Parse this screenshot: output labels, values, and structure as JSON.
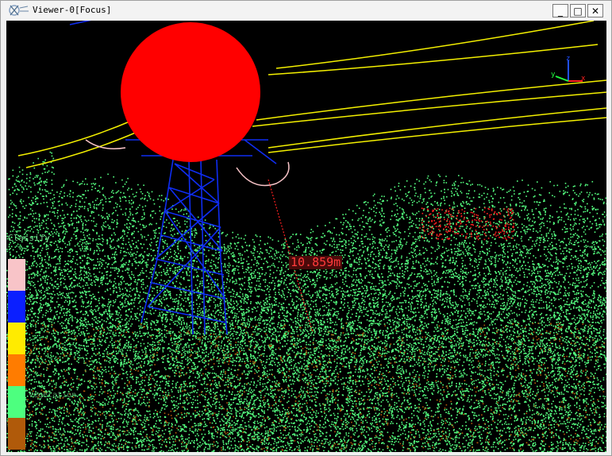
{
  "window": {
    "title": "Viewer-0[Focus]",
    "minimize_glyph": "_",
    "maximize_glyph": "□",
    "close_glyph": "✕"
  },
  "viewport": {
    "measurement_label": "10.859m",
    "legend_title": "Classify",
    "legend_colors": [
      "#f8c4c8",
      "#0b1fff",
      "#ffeb00",
      "#ff7c00",
      "#4dff7f",
      "#b05a0a"
    ],
    "legend_labels": [
      "",
      "",
      "",
      "",
      "Vegetation",
      ""
    ],
    "axis_labels": {
      "x": "x",
      "y": "y",
      "z": "z"
    },
    "colors": {
      "background": "#000000",
      "vegetation": "#55ff80",
      "tower": "#1030ff",
      "wires": "#f4f000",
      "marker": "#ff0000",
      "measure_line": "#ff2020"
    }
  }
}
